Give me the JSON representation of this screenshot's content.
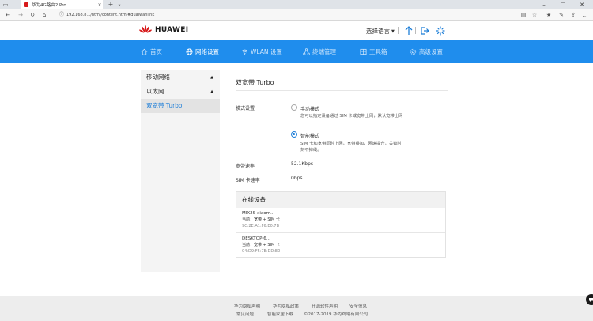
{
  "browser": {
    "tab_title": "华为4G路由2 Pro",
    "url": "192.168.8.1/html/content.html#dualwanlink",
    "new_tab": "+",
    "tab_close": "×"
  },
  "header": {
    "brand": "HUAWEI",
    "language_select": "选择语言",
    "brand_color": "#d71a1b"
  },
  "nav": {
    "color": "#1f8ded",
    "items": [
      {
        "label": "首页",
        "icon": "home-icon"
      },
      {
        "label": "网络设置",
        "icon": "globe-icon",
        "active": true
      },
      {
        "label": "WLAN 设置",
        "icon": "wifi-icon"
      },
      {
        "label": "终端管理",
        "icon": "devices-icon"
      },
      {
        "label": "工具箱",
        "icon": "toolbox-icon"
      },
      {
        "label": "高级设置",
        "icon": "gear-icon"
      }
    ]
  },
  "sidebar": {
    "items": [
      {
        "label": "移动网络",
        "expandable": true
      },
      {
        "label": "以太网",
        "expandable": true
      },
      {
        "label": "双宽带 Turbo",
        "active": true
      }
    ]
  },
  "content": {
    "title": "双宽带 Turbo",
    "mode_label": "模式设置",
    "modes": [
      {
        "label": "手动模式",
        "desc": "您可以指定设备通过 SIM 卡或宽带上网，默认宽带上网",
        "selected": false
      },
      {
        "label": "智能模式",
        "desc": "SIM 卡和宽带同时上网，宽带叠加，网速提升，关键时刻不掉线。",
        "selected": true
      }
    ],
    "broadband_rate_label": "宽带速率",
    "broadband_rate_value": "52.1Kbps",
    "sim_rate_label": "SIM 卡速率",
    "sim_rate_value": "0bps"
  },
  "online_devices": {
    "title": "在线设备",
    "devices": [
      {
        "name": "MIX2S-xiaom...",
        "current": "当前：宽带 + SIM 卡",
        "mac": "9C:2E:A1:F6:E0:7B"
      },
      {
        "name": "DESKTOP-6...",
        "current": "当前：宽带 + SIM 卡",
        "mac": "04:D9:F5:7E:DD:E0"
      }
    ]
  },
  "footer": {
    "row1": [
      "华为隐私声明",
      "华为隐私政策",
      "开源软件声明",
      "安全信息"
    ],
    "row2": [
      "常见问题",
      "智能家居下载",
      "©2017-2019 华为终端有限公司"
    ]
  }
}
